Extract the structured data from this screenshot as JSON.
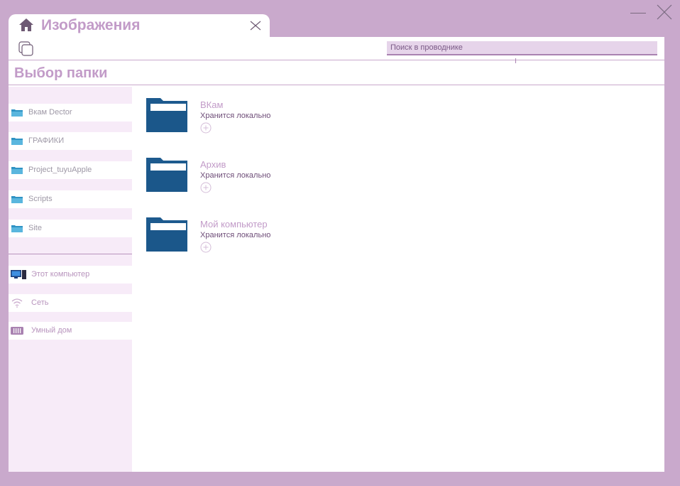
{
  "window": {
    "tab_title": "Изображения",
    "icons": {
      "minimize": "minimize-icon",
      "close": "close-icon",
      "home": "home-icon",
      "tab_close": "close-icon"
    }
  },
  "toolbar": {
    "copy_icon": "copy-icon",
    "search_placeholder": "Поиск в проводнике"
  },
  "heading": "Выбор папки",
  "sidebar": {
    "folders": [
      {
        "label": "Вкам Dector",
        "icon": "folder-icon"
      },
      {
        "label": "ГРАФИКИ",
        "icon": "folder-icon"
      },
      {
        "label": "Project_tuyuApple",
        "icon": "folder-icon"
      },
      {
        "label": "Scripts",
        "icon": "folder-icon"
      },
      {
        "label": "Site",
        "icon": "folder-icon"
      }
    ],
    "system": [
      {
        "label": "Этот компьютер",
        "icon": "computer-icon"
      },
      {
        "label": "Сеть",
        "icon": "wifi-icon"
      },
      {
        "label": "Умный дом",
        "icon": "smart-home-icon"
      }
    ]
  },
  "content": {
    "folders": [
      {
        "name": "ВКам",
        "status": "Хранится локально"
      },
      {
        "name": "Архив",
        "status": "Хранится локально"
      },
      {
        "name": "Мой компьютер",
        "status": "Хранится локально"
      }
    ]
  },
  "colors": {
    "frame": "#c9a9cc",
    "accent": "#c29bc8",
    "sidebar_bg": "#f7ebf8",
    "folder_blue": "#1d5a8e"
  }
}
